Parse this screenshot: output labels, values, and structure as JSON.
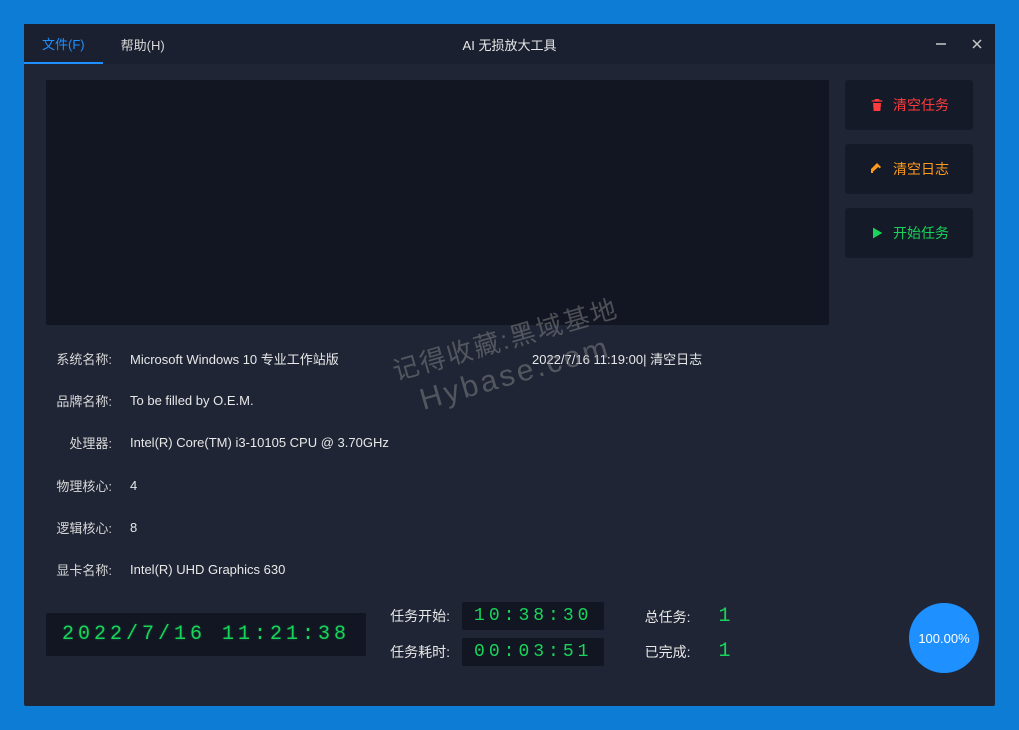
{
  "menu": {
    "file": "文件(F)",
    "help": "帮助(H)"
  },
  "title": "AI 无损放大工具",
  "buttons": {
    "clear_tasks": "清空任务",
    "clear_log": "清空日志",
    "start_tasks": "开始任务"
  },
  "sysinfo": {
    "labels": {
      "os": "系统名称:",
      "brand": "品牌名称:",
      "cpu": "处理器:",
      "phys_cores": "物理核心:",
      "logic_cores": "逻辑核心:",
      "gpu": "显卡名称:"
    },
    "values": {
      "os": "Microsoft Windows 10 专业工作站版",
      "brand": "To be filled by O.E.M.",
      "cpu": "Intel(R) Core(TM) i3-10105 CPU @ 3.70GHz",
      "phys_cores": "4",
      "logic_cores": "8",
      "gpu": "Intel(R) UHD Graphics 630"
    }
  },
  "log": {
    "line0": "2022/7/16 11:19:00| 清空日志"
  },
  "clock": {
    "now": "2022/7/16 11:21:38",
    "labels": {
      "start": "任务开始:",
      "elapsed": "任务耗时:",
      "total": "总任务:",
      "done": "已完成:"
    },
    "start_time": "10:38:30",
    "elapsed": "00:03:51",
    "total": "1",
    "done": "1"
  },
  "progress": {
    "percent": "100.00%"
  },
  "watermark": {
    "line1": "记得收藏:黑域基地",
    "line2": "Hybase.com"
  }
}
